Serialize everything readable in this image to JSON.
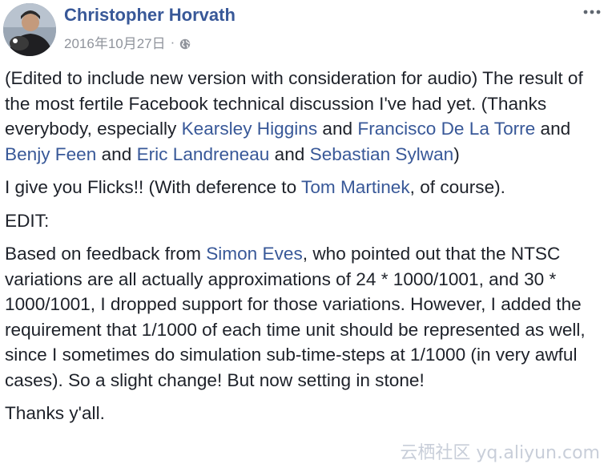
{
  "post": {
    "author": "Christopher Horvath",
    "timestamp": "2016年10月27日",
    "separator": "·",
    "privacy_icon": "globe-icon",
    "menu_icon": "more-options-icon",
    "paragraph1": {
      "text_a": "(Edited to include new version with consideration for audio) The result of the most fertile Facebook technical discussion I've had yet. (Thanks everybody, especially ",
      "mention1": "Kearsley Higgins",
      "and1": " and ",
      "mention2": "Francisco De La Torre",
      "and2": " and ",
      "mention3": "Benjy Feen",
      "and3": " and ",
      "mention4": "Eric Landreneau",
      "and4": " and ",
      "mention5": "Sebastian Sylwan",
      "text_end": ")"
    },
    "paragraph2": {
      "text_a": "I give you Flicks!! (With deference to ",
      "mention": "Tom Martinek",
      "text_end": ", of course)."
    },
    "paragraph3": "EDIT:",
    "paragraph4": {
      "text_a": "Based on feedback from ",
      "mention": "Simon Eves",
      "text_end": ", who pointed out that the NTSC variations are all actually approximations of 24 * 1000/1001, and 30 * 1000/1001, I dropped support for those variations. However, I added the requirement that 1/1000 of each time unit should be represented as well, since I sometimes do simulation sub-time-steps at 1/1000 (in very awful cases). So a slight change! But now setting in stone!"
    },
    "paragraph5": "Thanks y'all."
  },
  "watermark": "云栖社区 yq.aliyun.com",
  "colors": {
    "link": "#385898",
    "text": "#1d2129",
    "meta": "#90949c"
  }
}
